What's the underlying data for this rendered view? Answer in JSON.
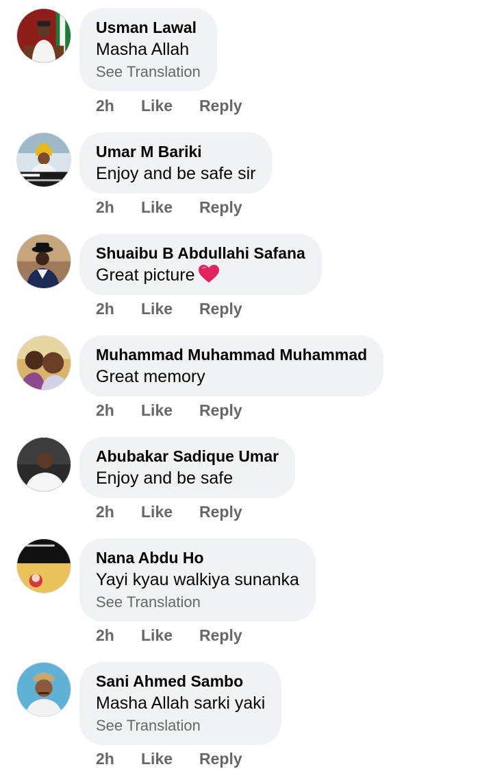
{
  "comments": [
    {
      "author": "Usman Lawal",
      "text": "Masha Allah",
      "see_translation": "See Translation",
      "time": "2h",
      "like": "Like",
      "reply": "Reply"
    },
    {
      "author": "Umar M Bariki",
      "text": "Enjoy and be safe sir",
      "time": "2h",
      "like": "Like",
      "reply": "Reply"
    },
    {
      "author": "Shuaibu B Abdullahi Safana",
      "text": "Great picture",
      "emoji": "red-heart",
      "time": "2h",
      "like": "Like",
      "reply": "Reply"
    },
    {
      "author": "Muhammad Muhammad Muhammad",
      "text": "Great memory",
      "time": "2h",
      "like": "Like",
      "reply": "Reply"
    },
    {
      "author": "Abubakar Sadique Umar",
      "text": "Enjoy and be safe",
      "time": "2h",
      "like": "Like",
      "reply": "Reply"
    },
    {
      "author": "Nana Abdu Ho",
      "text": "Yayi kyau walkiya sunanka",
      "see_translation": "See Translation",
      "time": "2h",
      "like": "Like",
      "reply": "Reply"
    },
    {
      "author": "Sani Ahmed Sambo",
      "text": "Masha Allah sarki yaki",
      "see_translation": "See Translation",
      "time": "2h",
      "like": "Like",
      "reply": "Reply"
    }
  ],
  "colors": {
    "bubble_bg": "#f0f2f5",
    "meta_text": "#65676b",
    "heart": "#e0245e"
  }
}
